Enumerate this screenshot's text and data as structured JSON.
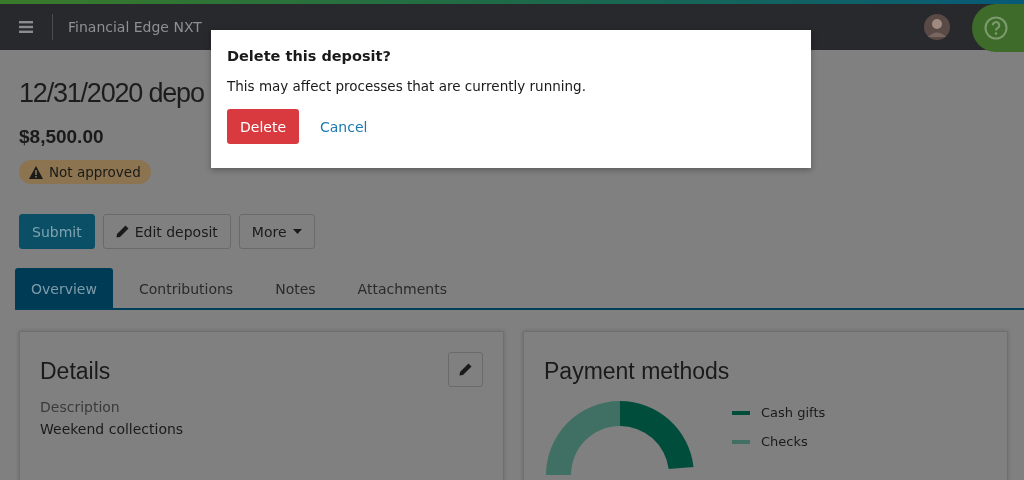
{
  "nav": {
    "app_title": "Financial Edge NXT"
  },
  "page": {
    "title": "12/31/2020 depo",
    "amount": "$8,500.00",
    "status": "Not approved"
  },
  "actions": [
    {
      "label": "Submit",
      "kind": "primary"
    },
    {
      "label": "Edit deposit",
      "kind": "edit"
    },
    {
      "label": "More",
      "kind": "dropdown"
    }
  ],
  "tabs": [
    {
      "label": "Overview",
      "selected": true
    },
    {
      "label": "Contributions",
      "selected": false
    },
    {
      "label": "Notes",
      "selected": false
    },
    {
      "label": "Attachments",
      "selected": false
    }
  ],
  "details": {
    "title": "Details",
    "fields": [
      {
        "label": "Description",
        "value": "Weekend collections"
      }
    ]
  },
  "payment_methods": {
    "title": "Payment methods",
    "legend": [
      {
        "label": "Cash gifts",
        "color": "#004d3b"
      },
      {
        "label": "Checks",
        "color": "#3f7063"
      }
    ]
  },
  "dialog": {
    "title": "Delete this deposit?",
    "message": "This may affect processes that are currently running.",
    "confirm": "Delete",
    "cancel": "Cancel"
  }
}
